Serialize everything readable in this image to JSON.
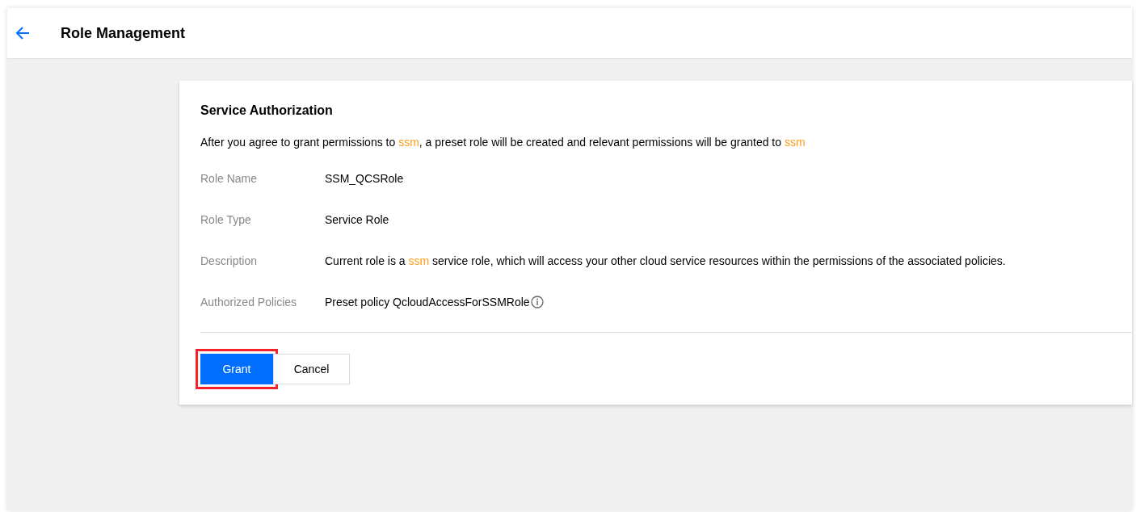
{
  "header": {
    "title": "Role Management"
  },
  "card": {
    "title": "Service Authorization",
    "intro": [
      {
        "text": "After you agree to grant permissions to ",
        "highlight": false
      },
      {
        "text": "ssm",
        "highlight": true
      },
      {
        "text": ", a preset role will be created and relevant permissions will be granted to ",
        "highlight": false
      },
      {
        "text": "ssm",
        "highlight": true
      }
    ],
    "fields": [
      {
        "label": "Role Name",
        "value": [
          {
            "text": "SSM_QCSRole",
            "highlight": false
          }
        ],
        "info": false
      },
      {
        "label": "Role Type",
        "value": [
          {
            "text": "Service Role",
            "highlight": false
          }
        ],
        "info": false
      },
      {
        "label": "Description",
        "value": [
          {
            "text": "Current role is a ",
            "highlight": false
          },
          {
            "text": "ssm",
            "highlight": true
          },
          {
            "text": " service role, which will access your other cloud service resources within the permissions of the associated policies.",
            "highlight": false
          }
        ],
        "info": false
      },
      {
        "label": "Authorized Policies",
        "value": [
          {
            "text": "Preset policy QcloudAccessForSSMRole",
            "highlight": false
          }
        ],
        "info": true
      }
    ],
    "buttons": [
      {
        "label": "Grant",
        "kind": "primary",
        "highlighted": true
      },
      {
        "label": "Cancel",
        "kind": "default",
        "highlighted": false
      }
    ]
  }
}
